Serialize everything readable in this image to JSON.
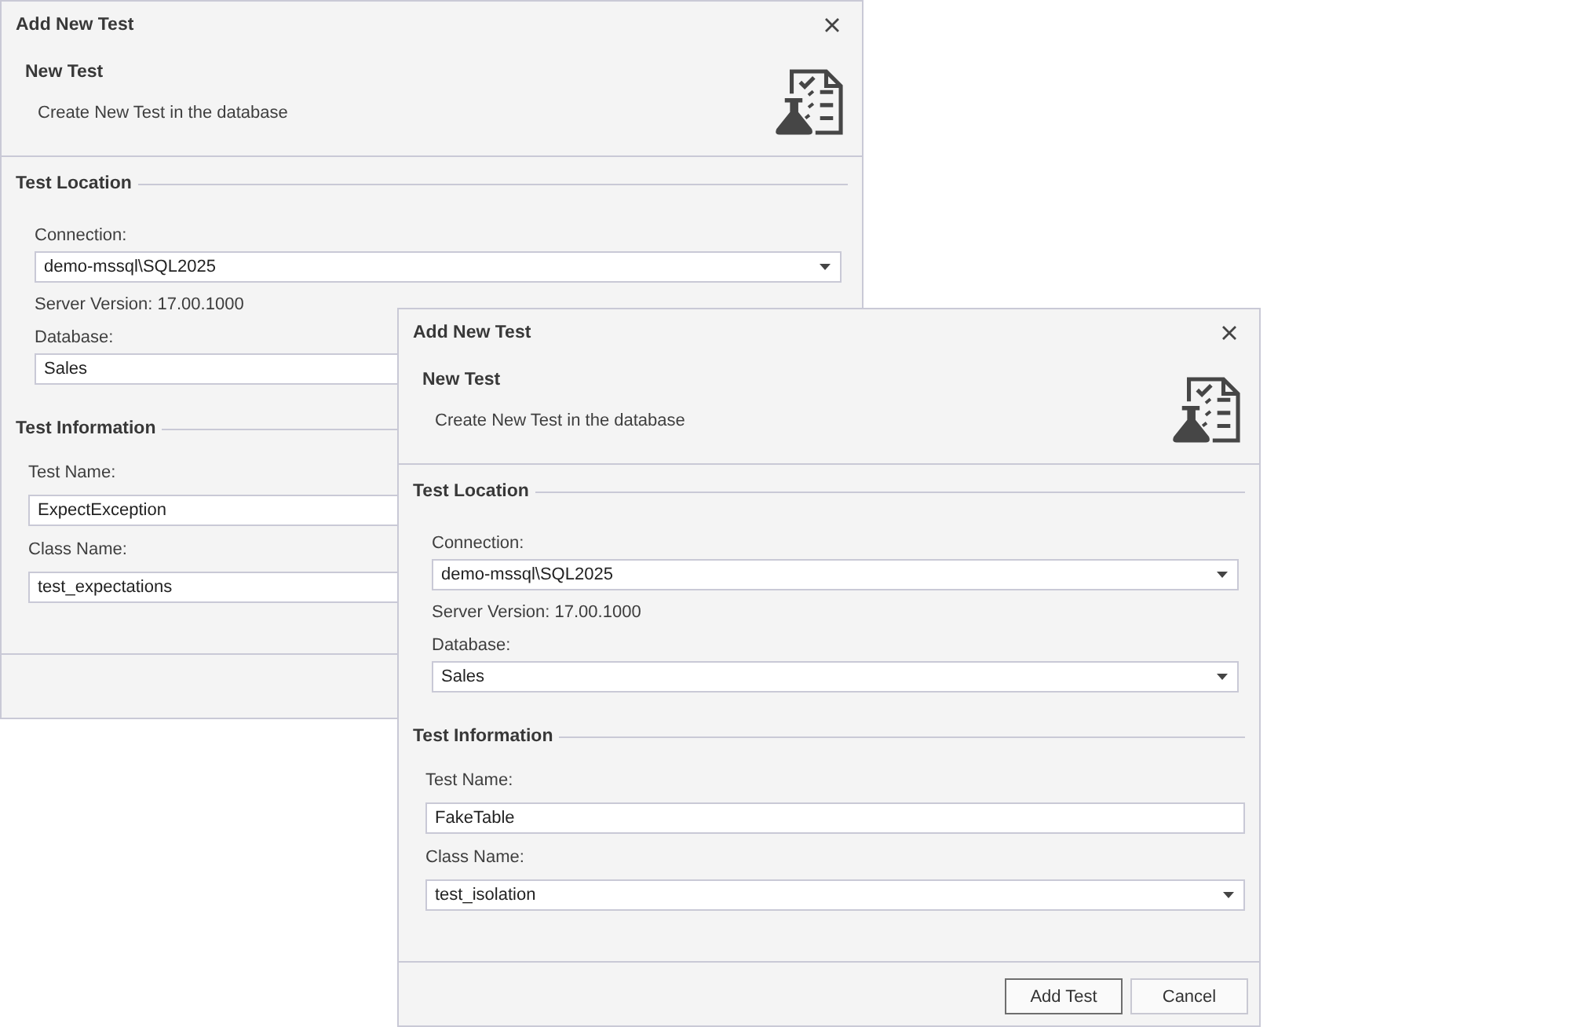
{
  "dialogs": [
    {
      "title": "Add New Test",
      "heading": "New Test",
      "description": "Create New Test in the database",
      "sections": [
        {
          "title": "Test Location",
          "items": [
            {
              "kind": "combo",
              "label": "Connection:",
              "value": "demo-mssql\\SQL2025"
            },
            {
              "kind": "note",
              "text": "Server Version: 17.00.1000"
            },
            {
              "kind": "text",
              "label": "Database:",
              "value": "Sales"
            }
          ]
        },
        {
          "title": "Test Information",
          "items": [
            {
              "kind": "text",
              "label": "Test Name:",
              "value": "ExpectException"
            },
            {
              "kind": "text",
              "label": "Class Name:",
              "value": "test_expectations"
            }
          ]
        }
      ]
    },
    {
      "title": "Add New Test",
      "heading": "New Test",
      "description": "Create New Test in the database",
      "sections": [
        {
          "title": "Test Location",
          "items": [
            {
              "kind": "combo",
              "label": "Connection:",
              "value": "demo-mssql\\SQL2025"
            },
            {
              "kind": "note",
              "text": "Server Version: 17.00.1000"
            },
            {
              "kind": "combo",
              "label": "Database:",
              "value": "Sales"
            }
          ]
        },
        {
          "title": "Test Information",
          "items": [
            {
              "kind": "text",
              "label": "Test Name:",
              "value": "FakeTable"
            },
            {
              "kind": "combo",
              "label": "Class Name:",
              "value": "test_isolation"
            }
          ]
        }
      ],
      "buttons": [
        {
          "label": "Add Test",
          "default": true
        },
        {
          "label": "Cancel",
          "default": false
        }
      ]
    }
  ]
}
